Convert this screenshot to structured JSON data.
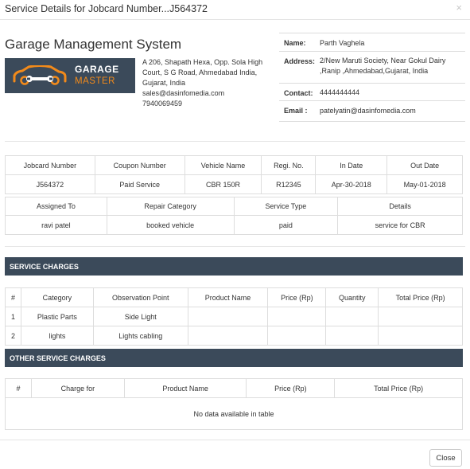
{
  "modal": {
    "title": "Service Details for Jobcard Number...J564372",
    "close_icon": "×",
    "close_button_label": "Close"
  },
  "company": {
    "system_title": "Garage Management System",
    "logo_line1": "GARAGE",
    "logo_line2": "MASTER",
    "address_lines": [
      "A 206, Shapath Hexa, Opp. Sola High",
      "Court, S G Road, Ahmedabad India,",
      "Gujarat, India",
      "sales@dasinfomedia.com",
      "7940069459"
    ]
  },
  "customer": {
    "name_label": "Name:",
    "name_value": "Parth Vaghela",
    "address_label": "Address:",
    "address_value": "2/New Maruti Society, Near Gokul Dairy ,Ranip ,Ahmedabad,Gujarat, India",
    "contact_label": "Contact:",
    "contact_value": "4444444444",
    "email_label": "Email :",
    "email_value": "patelyatin@dasinfomedia.com"
  },
  "jobcard": {
    "headers": [
      "Jobcard Number",
      "Coupon Number",
      "Vehicle Name",
      "Regi. No.",
      "In Date",
      "Out Date"
    ],
    "values": [
      "J564372",
      "Paid Service",
      "CBR 150R",
      "R12345",
      "Apr-30-2018",
      "May-01-2018"
    ]
  },
  "assignment": {
    "headers": [
      "Assigned To",
      "Repair Category",
      "Service Type",
      "Details"
    ],
    "values": [
      "ravi patel",
      "booked vehicle",
      "paid",
      "service for CBR"
    ]
  },
  "service_charges": {
    "title": "SERVICE CHARGES",
    "headers": [
      "#",
      "Category",
      "Observation Point",
      "Product Name",
      "Price (Rp)",
      "Quantity",
      "Total Price (Rp)"
    ],
    "rows": [
      [
        "1",
        "Plastic Parts",
        "Side Light",
        "",
        "",
        "",
        ""
      ],
      [
        "2",
        "lights",
        "Lights cabling",
        "",
        "",
        "",
        ""
      ]
    ]
  },
  "other_service_charges": {
    "title": "OTHER SERVICE CHARGES",
    "headers": [
      "#",
      "Charge for",
      "Product Name",
      "Price (Rp)",
      "Total Price (Rp)"
    ],
    "empty_message": "No data available in table"
  },
  "colors": {
    "section_bar": "#3b4a5a",
    "logo_accent": "#f28a1a",
    "border": "#dddddd"
  }
}
